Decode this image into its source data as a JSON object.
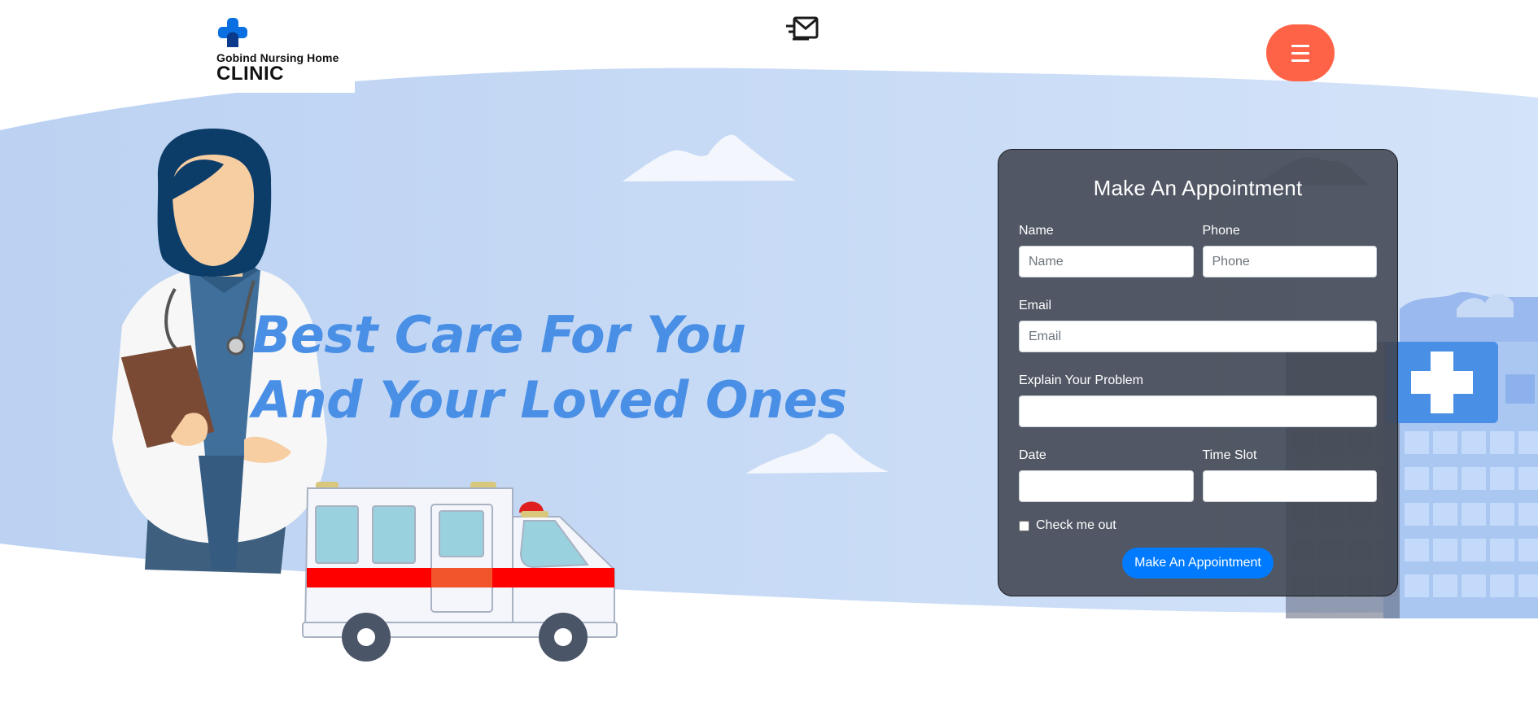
{
  "header": {
    "logo_line1": "Gobind Nursing Home",
    "logo_line2": "CLINIC",
    "logo_icon": "medical-cross-icon",
    "mail_icon": "fast-mail-icon",
    "menu_icon": "hamburger-menu-icon"
  },
  "hero": {
    "line1": "Best Care For You",
    "line2": "And Your Loved Ones"
  },
  "appointment_form": {
    "title": "Make An Appointment",
    "name_label": "Name",
    "name_placeholder": "Name",
    "phone_label": "Phone",
    "phone_placeholder": "Phone",
    "email_label": "Email",
    "email_placeholder": "Email",
    "problem_label": "Explain Your Problem",
    "date_label": "Date",
    "time_label": "Time Slot",
    "checkbox_label": "Check me out",
    "submit_label": "Make An Appointment"
  },
  "colors": {
    "accent_orange": "#ff6347",
    "primary_blue": "#007bff",
    "hero_text": "#4a8fe6",
    "background_blue": "#c6d9f5",
    "card_bg": "#404450"
  }
}
